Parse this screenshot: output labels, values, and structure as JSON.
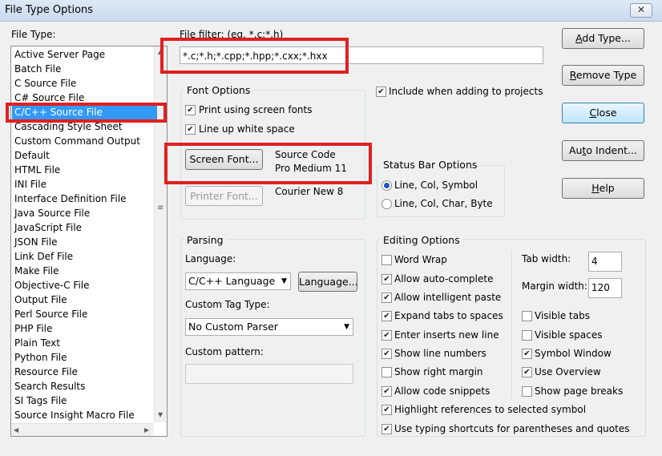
{
  "window": {
    "title": "File Type Options",
    "close_glyph": "✕"
  },
  "file_type": {
    "label": "File Type:",
    "items": [
      "Active Server Page",
      "Batch File",
      "C Source File",
      "C# Source File",
      "C/C++ Source File",
      "Cascading Style Sheet",
      "Custom Command Output",
      "Default",
      "HTML File",
      "INI File",
      "Interface Definition File",
      "Java Source File",
      "JavaScript File",
      "JSON File",
      "Link Def File",
      "Make File",
      "Objective-C File",
      "Output File",
      "Perl Source File",
      "PHP File",
      "Plain Text",
      "Python File",
      "Resource File",
      "Search Results",
      "SI Tags File",
      "Source Insight Macro File"
    ],
    "selected": "C/C++ Source File"
  },
  "file_filter": {
    "label": "File filter: (eg. *.c;*.h)",
    "value": "*.c;*.h;*.cpp;*.hpp;*.cxx;*.hxx"
  },
  "font_options": {
    "title": "Font Options",
    "print_screen_fonts": {
      "label": "Print using screen fonts",
      "checked": true
    },
    "line_up_whitespace": {
      "label": "Line up white space",
      "checked": true
    },
    "screen_font_button": "Screen Font...",
    "screen_font_value_line1": "Source Code",
    "screen_font_value_line2": "Pro Medium 11",
    "printer_font_button": "Printer Font...",
    "printer_font_value": "Courier New 8"
  },
  "include_in_projects": {
    "label": "Include when adding to projects",
    "checked": true
  },
  "status_bar": {
    "title": "Status Bar Options",
    "options": [
      "Line, Col, Symbol",
      "Line, Col, Char, Byte"
    ],
    "selected": "Line, Col, Symbol"
  },
  "buttons": {
    "add_type": "Add Type...",
    "remove_type": "Remove Type",
    "close": "Close",
    "auto_indent": "Auto Indent...",
    "help": "Help"
  },
  "parsing": {
    "title": "Parsing",
    "language_label": "Language:",
    "language_value": "C/C++ Language",
    "language_button": "Language...",
    "custom_tag_label": "Custom Tag Type:",
    "custom_tag_value": "No Custom Parser",
    "custom_pattern_label": "Custom pattern:",
    "custom_pattern_value": ""
  },
  "editing": {
    "title": "Editing Options",
    "left": [
      {
        "label": "Word Wrap",
        "checked": false
      },
      {
        "label": "Allow auto-complete",
        "checked": true
      },
      {
        "label": "Allow intelligent paste",
        "checked": true
      },
      {
        "label": "Expand tabs to spaces",
        "checked": true
      },
      {
        "label": "Enter inserts new line",
        "checked": true
      },
      {
        "label": "Show line numbers",
        "checked": true
      },
      {
        "label": "Show right margin",
        "checked": false
      },
      {
        "label": "Allow code snippets",
        "checked": true
      }
    ],
    "right": [
      {
        "label": "Visible tabs",
        "checked": false
      },
      {
        "label": "Visible spaces",
        "checked": false
      },
      {
        "label": "Symbol Window",
        "checked": true
      },
      {
        "label": "Use Overview",
        "checked": true
      },
      {
        "label": "Show page breaks",
        "checked": false
      }
    ],
    "wide": [
      {
        "label": "Highlight references to selected symbol",
        "checked": true
      },
      {
        "label": "Use typing shortcuts for parentheses and quotes",
        "checked": true
      }
    ],
    "tab_width_label": "Tab width:",
    "tab_width_value": "4",
    "margin_width_label": "Margin width:",
    "margin_width_value": "120"
  },
  "glyphs": {
    "check": "✔",
    "dropdown": "▼",
    "up": "▲",
    "down": "▼",
    "left": "◀",
    "right": "▶",
    "grip": "≡"
  }
}
